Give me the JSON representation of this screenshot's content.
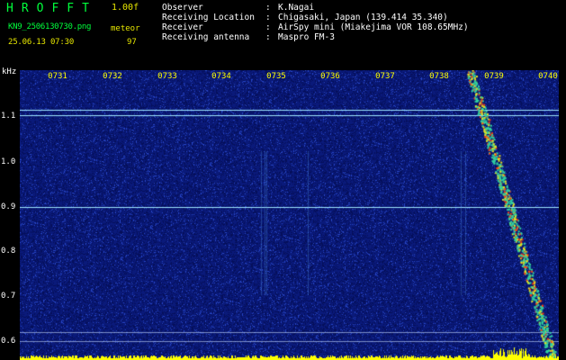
{
  "header": {
    "app_title": "HROFFT",
    "version": "1.00f",
    "filename": "KN9_2506130730.png",
    "datetime": "25.06.13 07:30",
    "meteor_label": "meteor",
    "meteor_count": "97"
  },
  "info": [
    {
      "key": "Observer",
      "sep": ":",
      "value": "K.Nagai"
    },
    {
      "key": "Receiving Location",
      "sep": ":",
      "value": "Chigasaki, Japan (139.414 35.340)"
    },
    {
      "key": "Receiver",
      "sep": ":",
      "value": "AirSpy mini (Miakejima VOR 108.65MHz)"
    },
    {
      "key": "Receiving antenna",
      "sep": ":",
      "value": "Maspro FM-3"
    }
  ],
  "axis": {
    "unit": "kHz",
    "y_ticks": [
      "1.1",
      "1.0",
      "0.9",
      "0.8",
      "0.7",
      "0.6"
    ],
    "x_ticks": [
      "0731",
      "0732",
      "0733",
      "0734",
      "0735",
      "0736",
      "0737",
      "0738",
      "0739",
      "0740"
    ]
  },
  "colors": {
    "background": "#0a1a7a",
    "tick_text": "#ffff00",
    "title_green": "#00ff3c",
    "carrier_line": "#8fe0ff",
    "meteor_trail": "#ff4010"
  }
}
